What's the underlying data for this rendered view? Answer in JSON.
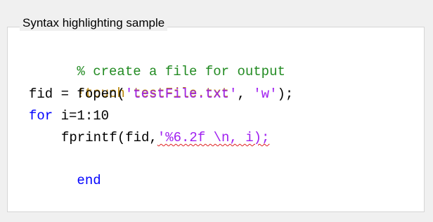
{
  "group": {
    "title": "Syntax highlighting sample"
  },
  "code": {
    "line1": {
      "comment": "% create a file for output"
    },
    "line2": {
      "command": "!touch testFile.txt"
    },
    "line3": {
      "before": "fid = fopen(",
      "string1": "'testFile.txt'",
      "between": ", ",
      "string2": "'w'",
      "after": ");"
    },
    "line4": {
      "keyword": "for",
      "rest": " i=1:10"
    },
    "line5": {
      "call": "fprintf(fid,",
      "unterminated_string": "'%6.2f \\n, i);"
    },
    "line6": {
      "keyword": "end"
    }
  },
  "colors": {
    "comment": "#228b22",
    "system_command": "#b8860b",
    "keyword": "#0000ff",
    "string": "#a020f0",
    "syntax_error_underline": "#e02020"
  }
}
